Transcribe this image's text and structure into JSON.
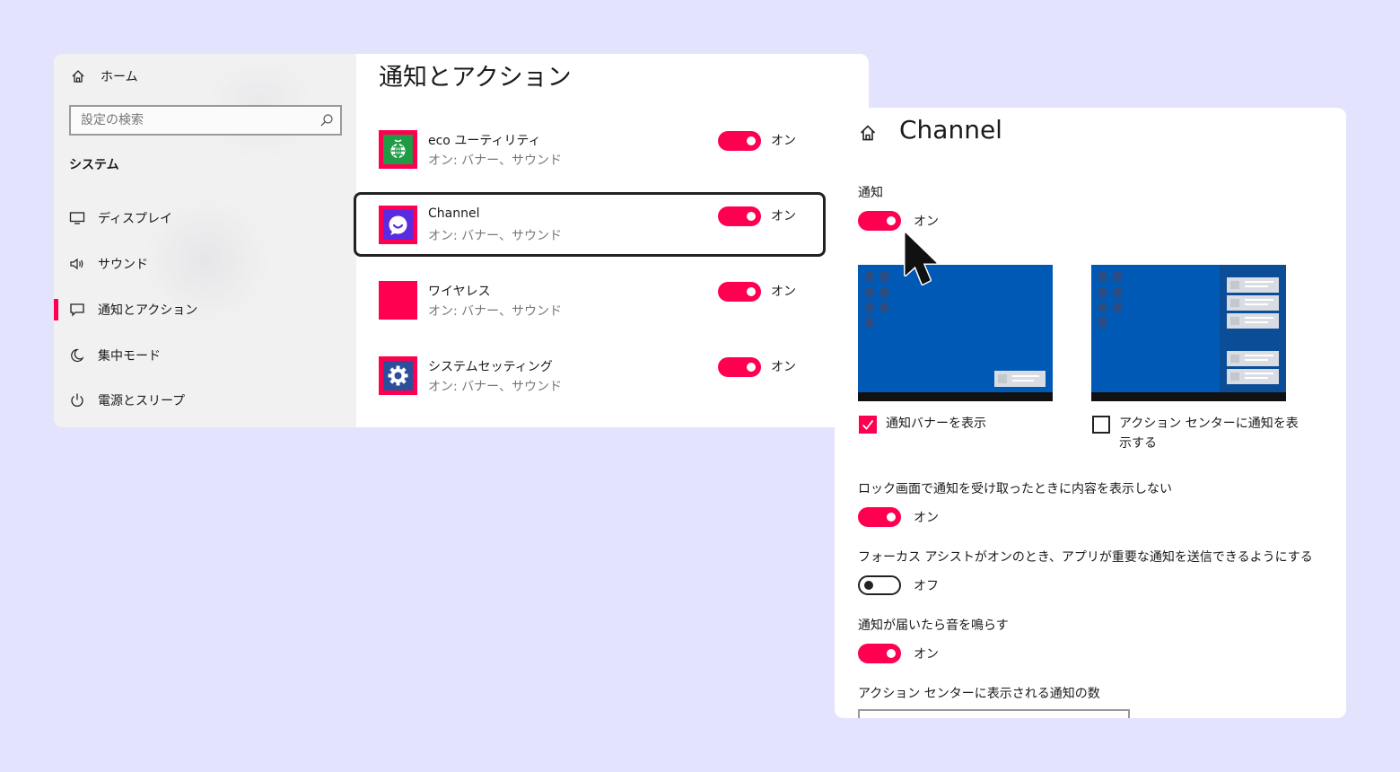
{
  "left_window": {
    "sidebar": {
      "home_label": "ホーム",
      "search_placeholder": "設定の検索",
      "section_header": "システム",
      "items": [
        {
          "label": "ディスプレイ",
          "icon": "monitor-icon"
        },
        {
          "label": "サウンド",
          "icon": "speaker-icon"
        },
        {
          "label": "通知とアクション",
          "icon": "notification-icon",
          "active": true
        },
        {
          "label": "集中モード",
          "icon": "moon-icon"
        },
        {
          "label": "電源とスリープ",
          "icon": "power-icon"
        }
      ]
    },
    "main": {
      "title": "通知とアクション",
      "apps": [
        {
          "name": "eco ユーティリティ",
          "detail": "オン: バナー、サウンド",
          "toggle_label": "オン",
          "toggle_on": true,
          "icon": "globe-app-icon",
          "icon_color": "#1f9a45"
        },
        {
          "name": "Channel",
          "detail": "オン: バナー、サウンド",
          "toggle_label": "オン",
          "toggle_on": true,
          "icon": "chat-bubble-app-icon",
          "icon_color": "#5b2be0",
          "focused": true
        },
        {
          "name": "ワイヤレス",
          "detail": "オン: バナー、サウンド",
          "toggle_label": "オン",
          "toggle_on": true,
          "icon": "blank-app-icon",
          "icon_color": "#ff0050"
        },
        {
          "name": "システムセッティング",
          "detail": "オン: バナー、サウンド",
          "toggle_label": "オン",
          "toggle_on": true,
          "icon": "gear-app-icon",
          "icon_color": "#2b4f9a"
        }
      ]
    }
  },
  "right_window": {
    "page_title": "Channel",
    "notification": {
      "label": "通知",
      "toggle_label": "オン",
      "on": true
    },
    "banner_option": {
      "label": "通知バナーを表示",
      "checked": true
    },
    "action_center_option": {
      "label_line1": "アクション センターに通知を表",
      "label_line2": "示する",
      "checked": false
    },
    "lock_screen": {
      "label": "ロック画面で通知を受け取ったときに内容を表示しない",
      "toggle_label": "オン",
      "on": true
    },
    "focus_assist": {
      "label": "フォーカス アシストがオンのとき、アプリが重要な通知を送信できるようにする",
      "toggle_label": "オフ",
      "on": false
    },
    "sound": {
      "label": "通知が届いたら音を鳴らす",
      "toggle_label": "オン",
      "on": true
    },
    "count_label": "アクション センターに表示される通知の数"
  },
  "colors": {
    "accent": "#ff0050",
    "background": "#e3e3fd",
    "desktop_blue": "#005ab5"
  }
}
